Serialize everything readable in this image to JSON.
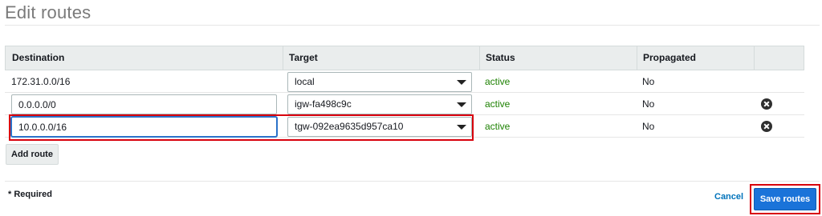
{
  "page": {
    "title": "Edit routes"
  },
  "table": {
    "headers": [
      "Destination",
      "Target",
      "Status",
      "Propagated"
    ],
    "rows": [
      {
        "destination": "172.31.0.0/16",
        "target": "local",
        "status": "active",
        "propagated": "No"
      },
      {
        "destination": "0.0.0.0/0",
        "target": "igw-fa498c9c",
        "status": "active",
        "propagated": "No"
      },
      {
        "destination": "10.0.0.0/16",
        "target": "tgw-092ea9635d957ca10",
        "status": "active",
        "propagated": "No"
      }
    ]
  },
  "actions": {
    "add_route": "Add route",
    "required_note": "* Required",
    "cancel": "Cancel",
    "save": "Save routes"
  },
  "colors": {
    "status_active": "#1d8102",
    "primary_button": "#1a73d9",
    "link": "#0073bb",
    "highlight": "#d8000c"
  },
  "icons": {
    "remove": "close-circle-icon",
    "select": "caret-down-icon"
  }
}
